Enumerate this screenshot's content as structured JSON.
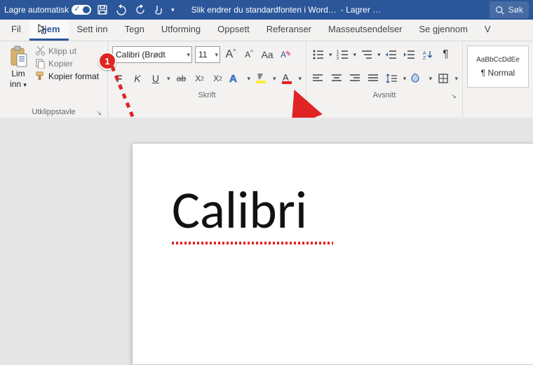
{
  "titlebar": {
    "autosave_label": "Lagre automatisk",
    "document_title": "Slik endrer du standardfonten i Word…",
    "saving_status": "- Lagrer …",
    "search_label": "Søk"
  },
  "tabs": {
    "file": "Fil",
    "home": "Hjem",
    "insert": "Sett inn",
    "draw": "Tegn",
    "design": "Utforming",
    "layout": "Oppsett",
    "references": "Referanser",
    "mailings": "Masseutsendelser",
    "review": "Se gjennom",
    "partial": "V"
  },
  "clipboard": {
    "paste_line1": "Lim",
    "paste_line2": "inn",
    "cut": "Klipp ut",
    "copy": "Kopier",
    "format_painter": "Kopier format",
    "group_label": "Utklippstavle"
  },
  "font": {
    "font_name": "Calibri (Brødt",
    "font_size": "11",
    "group_label": "Skrift"
  },
  "paragraph": {
    "group_label": "Avsnitt"
  },
  "styles": {
    "sample": "AaBbCcDdEe",
    "normal": "¶ Normal"
  },
  "document": {
    "body_text": "Calibri"
  },
  "callouts": {
    "one": "1"
  },
  "icons": {
    "grow_font": "Â",
    "shrink_font": "Â",
    "change_case": "Aa",
    "clear_format": "A",
    "bold": "F",
    "italic": "K",
    "underline": "U",
    "strike": "ab",
    "subscript": "X",
    "superscript": "X"
  }
}
